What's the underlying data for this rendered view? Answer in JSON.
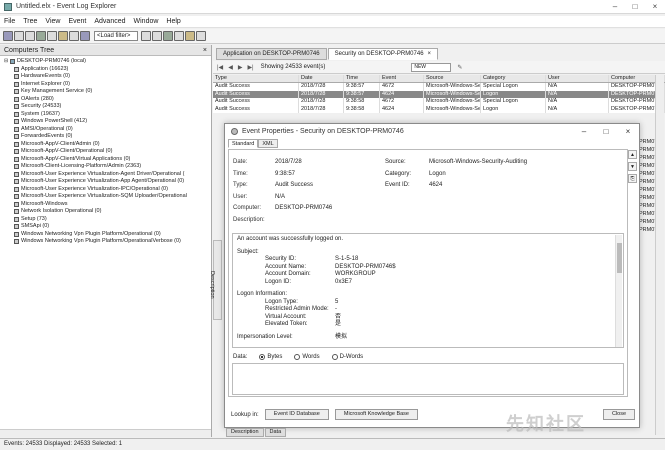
{
  "window": {
    "title": "Untitled.elx - Event Log Explorer"
  },
  "menu": [
    "File",
    "Tree",
    "View",
    "Event",
    "Advanced",
    "Window",
    "Help"
  ],
  "toolbar": {
    "filter_combo": "<Load filter>"
  },
  "left_pane": {
    "title": "Computers Tree",
    "close": "×",
    "root": "DESKTOP-PRM0746 (local)",
    "items": [
      "Application (16623)",
      "HardwareEvents (0)",
      "Internet Explorer (0)",
      "Key Management Service (0)",
      "OAlerts (280)",
      "Security (24533)",
      "System (19637)",
      "Windows PowerShell (412)",
      "AMSI/Operational (0)",
      "ForwardedEvents (0)",
      "Microsoft-AppV-Client/Admin (0)",
      "Microsoft-AppV-Client/Operational (0)",
      "Microsoft-AppV-Client/Virtual Applications (0)",
      "Microsoft-Client-Licensing-Platform/Admin (2363)",
      "Microsoft-User Experience Virtualization-Agent Driver/Operational (",
      "Microsoft-User Experience Virtualization-App Agent/Operational (0)",
      "Microsoft-User Experience Virtualization-IPC/Operational (0)",
      "Microsoft-User Experience Virtualization-SQM Uploader/Operational",
      "Microsoft-Windows",
      "Network Isolation Operational (0)",
      "Setup (73)",
      "SMSApi (0)",
      "Windows Networking Vpn Plugin Platform/Operational (0)",
      "Windows Networking Vpn Plugin Platform/OperationalVerbose (0)"
    ]
  },
  "tabs": [
    {
      "label": "Application on DESKTOP-PRM0746"
    },
    {
      "label": "Security on DESKTOP-PRM0746",
      "close": "×"
    }
  ],
  "navbar": {
    "showing": "Showing 24533 event(s)",
    "filter_label": "NEW"
  },
  "grid": {
    "columns": [
      "Type",
      "Date",
      "Time",
      "Event",
      "Source",
      "Category",
      "User",
      "Computer"
    ],
    "rows": [
      [
        "Audit Success",
        "2018/7/28",
        "9:38:57",
        "4672",
        "Microsoft-Windows-Se",
        "Special Logon",
        "N/A",
        "DESKTOP-PRM0746"
      ],
      [
        "Audit Success",
        "2018/7/28",
        "9:38:57",
        "4624",
        "Microsoft-Windows-Se",
        "Logon",
        "N/A",
        "DESKTOP-PRM0746"
      ],
      [
        "Audit Success",
        "2018/7/28",
        "9:38:58",
        "4672",
        "Microsoft-Windows-Se",
        "Special Logon",
        "N/A",
        "DESKTOP-PRM0746"
      ],
      [
        "Audit Success",
        "2018/7/28",
        "9:38:58",
        "4624",
        "Microsoft-Windows-Se",
        "Logon",
        "N/A",
        "DESKTOP-PRM0746"
      ]
    ],
    "right_col_rest": [
      "DESKTOP-PRM0746",
      "DESKTOP-PRM0746",
      "DESKTOP-PRM0746",
      "DESKTOP-PRM0746",
      "DESKTOP-PRM0746",
      "DESKTOP-PRM0746",
      "DESKTOP-PRM0746",
      "DESKTOP-PRM0746",
      "DESKTOP-PRM0746",
      "DESKTOP-PRM0746",
      "DESKTOP-PRM0746",
      "DESKTOP-PRM0746"
    ]
  },
  "sidetab": "Description",
  "dialog": {
    "title": "Event Properties - Security on DESKTOP-PRM0746",
    "tabs": [
      "Standard",
      "XML"
    ],
    "date_label": "Date:",
    "date": "2018/7/28",
    "time_label": "Time:",
    "time": "9:38:57",
    "type_label": "Type:",
    "type": "Audit Success",
    "user_label": "User:",
    "user": "N/A",
    "computer_label": "Computer:",
    "computer": "DESKTOP-PRM0746",
    "source_label": "Source:",
    "source": "Microsoft-Windows-Security-Auditing",
    "category_label": "Category:",
    "category": "Logon",
    "eventid_label": "Event ID:",
    "eventid": "4624",
    "description_label": "Description:",
    "desc": {
      "line1": "An account was successfully logged on.",
      "subject": "Subject:",
      "sid_k": "Security ID:",
      "sid_v": "S-1-5-18",
      "acct_k": "Account Name:",
      "acct_v": "DESKTOP-PRM0746$",
      "domain_k": "Account Domain:",
      "domain_v": "WORKGROUP",
      "logonid_k": "Logon ID:",
      "logonid_v": "0x3E7",
      "logoninfo": "Logon Information:",
      "ltype_k": "Logon Type:",
      "ltype_v": "5",
      "restricted_k": "Restricted Admin Mode:",
      "restricted_v": "-",
      "virtual_k": "Virtual Account:",
      "virtual_v": "否",
      "elevated_k": "Elevated Token:",
      "elevated_v": "是",
      "imp_k": "Impersonation Level:",
      "imp_v": "模拟"
    },
    "data_label": "Data:",
    "data_opts": [
      "Bytes",
      "Words",
      "D-Words"
    ],
    "lookup_label": "Lookup in:",
    "btn_eventid": "Event ID Database",
    "btn_kb": "Microsoft Knowledge Base",
    "btn_close": "Close"
  },
  "bottom_tabs": [
    "Description",
    "Data"
  ],
  "status": "Events: 24533   Displayed: 24533   Selected: 1",
  "watermark": "先知社区"
}
